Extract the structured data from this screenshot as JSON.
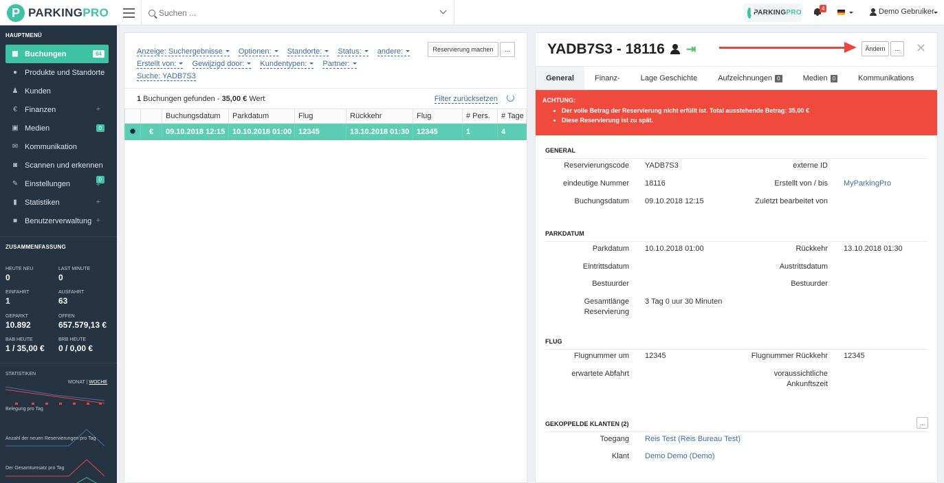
{
  "brand": {
    "name_a": "PARKING",
    "name_b": "PRO"
  },
  "search": {
    "placeholder": "Suchen ..."
  },
  "notifications": {
    "count": "4"
  },
  "user": {
    "name": "Demo Gebruiker"
  },
  "sidebar": {
    "menu_heading": "HAUPTMENÜ",
    "items": [
      {
        "label": "Buchungen",
        "icon": "calendar-icon",
        "badge": "64"
      },
      {
        "label": "Produkte und Standorte",
        "icon": "map-marker-icon"
      },
      {
        "label": "Kunden",
        "icon": "user-icon"
      },
      {
        "label": "Finanzen",
        "icon": "euro-icon"
      },
      {
        "label": "Medien",
        "icon": "image-icon",
        "badge": "0"
      },
      {
        "label": "Kommunikation",
        "icon": "envelope-icon"
      },
      {
        "label": "Scannen und erkennen",
        "icon": "camera-icon"
      },
      {
        "label": "Einstellungen",
        "icon": "wrench-icon",
        "badge": "0"
      },
      {
        "label": "Statistiken",
        "icon": "bar-chart-icon"
      },
      {
        "label": "Benutzerverwaltung",
        "icon": "lock-icon"
      }
    ],
    "summary_heading": "ZUSAMMENFASSUNG",
    "summary": [
      {
        "label": "HEUTE NEU",
        "value": "0"
      },
      {
        "label": "LAST MINUTE",
        "value": "0"
      },
      {
        "label": "EINFAHRT",
        "value": "1"
      },
      {
        "label": "AUSFAHRT",
        "value": "63"
      },
      {
        "label": "GEPARKT",
        "value": "10.892"
      },
      {
        "label": "OFFEN",
        "value": "657.579,13 €"
      },
      {
        "label": "BAB HEUTE",
        "value": "1 / 35,00 €"
      },
      {
        "label": "BRB HEUTE",
        "value": "0 / 0,00 €"
      }
    ],
    "stats_heading": "STATISTIKEN",
    "stats_toggle": {
      "monat": "MONAT",
      "woche": "WOCHE"
    },
    "sparklines": [
      {
        "label": "Belegung pro Tag"
      },
      {
        "label": "Anzahl der neuen Reservierungen pro Tag"
      },
      {
        "label": "Der Gesamtumsatz pro Tag"
      }
    ]
  },
  "list": {
    "filters": [
      "Anzeige: Suchergebnisse",
      "Optionen:",
      "Standorte:",
      "Status:",
      "andere:",
      "Erstellt von:",
      "Gewijzigd door:",
      "Kundentypen:",
      "Partner:"
    ],
    "search_filter": "Suche: YADB7S3",
    "new_reservation": "Reservierung machen",
    "more": "...",
    "summary_count": "1",
    "summary_text": " Buchungen gefunden - ",
    "summary_amount": "35,00 €",
    "summary_suffix": " Wert",
    "reset_filter": "Filter zurücksetzen",
    "columns": [
      "",
      "",
      "Buchungsdatum",
      "Parkdatum",
      "Flug",
      "Rückkehr",
      "Flug",
      "# Pers.",
      "# Tage"
    ],
    "rows": [
      {
        "currency": "€",
        "buchungsdatum": "09.10.2018 12:15",
        "parkdatum": "10.10.2018 01:00",
        "flug": "12345",
        "rueckkehr": "13.10.2018 01:30",
        "flug2": "12345",
        "pers": "1",
        "tage": "4"
      }
    ]
  },
  "detail": {
    "title": "YADB7S3 - 18116",
    "edit": "Ändern",
    "more": "...",
    "tabs": [
      {
        "label": "General"
      },
      {
        "label": "Finanz-"
      },
      {
        "label": "Lage Geschichte"
      },
      {
        "label": "Aufzeichnungen",
        "count": "0"
      },
      {
        "label": "Medien",
        "count": "0"
      },
      {
        "label": "Kommunikations"
      }
    ],
    "alert": {
      "title": "ACHTUNG:",
      "items": [
        "Der volle Betrag der Reservierung nicht erfüllt ist. Total ausstehende Betrag: 35,00 €",
        "Diese Reservierung ist zu spät."
      ]
    },
    "general": {
      "heading": "GENERAL",
      "reservierungscode_label": "Reservierungscode",
      "reservierungscode": "YADB7S3",
      "externe_id_label": "externe ID",
      "nummer_label": "eindeutige Nummer",
      "nummer": "18116",
      "erstellt_label": "Erstellt von / bis",
      "erstellt": "MyParkingPro",
      "buchungsdatum_label": "Buchungsdatum",
      "buchungsdatum": "09.10.2018 12:15",
      "bearbeitet_label": "Zuletzt bearbeitet von"
    },
    "parkdatum": {
      "heading": "PARKDATUM",
      "parkdatum_label": "Parkdatum",
      "parkdatum": "10.10.2018 01:00",
      "rueckkehr_label": "Rückkehr",
      "rueckkehr": "13.10.2018 01:30",
      "eintritt_label": "Eintrittsdatum",
      "austritt_label": "Austrittsdatum",
      "bestuurder1_label": "Bestuurder",
      "bestuurder2_label": "Bestuurder",
      "laenge_label_1": "Gesamtlänge",
      "laenge_label_2": "Reservierung",
      "laenge": "3 Tag 0 uur 30 Minuten"
    },
    "flug": {
      "heading": "FLUG",
      "flugnummer_label": "Flugnummer um",
      "flugnummer": "12345",
      "flug_rueck_label": "Flugnummer Rückkehr",
      "flug_rueck": "12345",
      "abfahrt_label": "erwartete Abfahrt",
      "ankunft_label_1": "voraussichtliche",
      "ankunft_label_2": "Ankunftszeit"
    },
    "klanten": {
      "heading": "GEKOPPELDE KLANTEN (2)",
      "more": "...",
      "toegang_label": "Toegang",
      "toegang": "Reis Test (Reis Bureau Test)",
      "klant_label": "Klant",
      "klant": "Demo Demo (Demo)"
    }
  },
  "colors": {
    "accent": "#3dc3a4",
    "sidebar": "#253342",
    "alert": "#ef4a3d",
    "link": "#3a6ea5"
  }
}
